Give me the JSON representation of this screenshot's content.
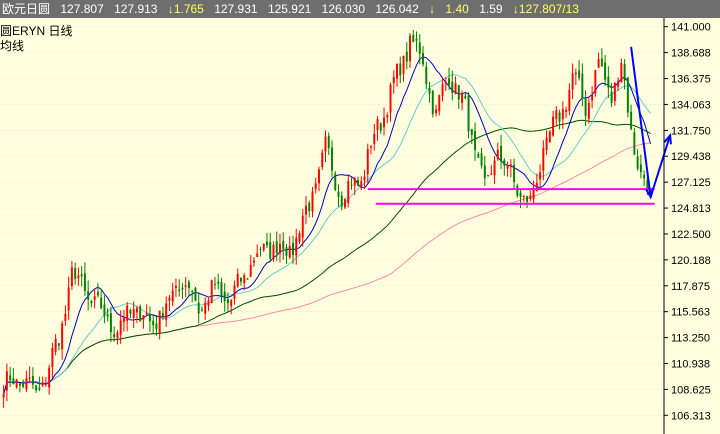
{
  "header": {
    "symbol": "欧元日圆",
    "open": "127.807",
    "high": "127.913",
    "change": "↓1.765",
    "v4": "127.931",
    "v5": "125.921",
    "v6": "126.030",
    "v7": "126.042",
    "arrow": "↓",
    "v8": "1.40",
    "v9": "1.59",
    "v10": "↓127.807/13"
  },
  "legend": {
    "line1": "圆ERYN  日线",
    "line2": "均线"
  },
  "colors": {
    "bg": "#ffffe0",
    "up": "#ff0000",
    "down": "#008000",
    "ma_short": "#0000cc",
    "ma_mid": "#66cccc",
    "ma_long": "#004d00",
    "ma_vlong": "#ff88aa",
    "support": "#ff00ff",
    "annot": "#0000ff",
    "grid": "#cccc99"
  },
  "chart_data": {
    "type": "candlestick",
    "ylim": [
      105.0,
      141.6
    ],
    "yticks": [
      "141.000",
      "138.688",
      "136.375",
      "134.063",
      "131.750",
      "129.438",
      "127.125",
      "124.813",
      "122.500",
      "120.188",
      "117.875",
      "115.563",
      "113.250",
      "110.938",
      "108.625",
      "106.313"
    ],
    "ytick_values": [
      141.0,
      138.688,
      136.375,
      134.063,
      131.75,
      129.438,
      127.125,
      124.813,
      122.5,
      120.188,
      117.875,
      115.563,
      113.25,
      110.938,
      108.625,
      106.313
    ],
    "n_bars": 200,
    "trend": [
      [
        0,
        109.0
      ],
      [
        6,
        109.6
      ],
      [
        10,
        108.0
      ],
      [
        13,
        110.0
      ],
      [
        17,
        113.0
      ],
      [
        21,
        119.0
      ],
      [
        26,
        117.0
      ],
      [
        30,
        115.5
      ],
      [
        35,
        114.0
      ],
      [
        40,
        116.0
      ],
      [
        45,
        114.5
      ],
      [
        50,
        116.0
      ],
      [
        55,
        118.5
      ],
      [
        60,
        116.0
      ],
      [
        65,
        117.5
      ],
      [
        70,
        116.5
      ],
      [
        76,
        120.0
      ],
      [
        82,
        121.5
      ],
      [
        88,
        121.0
      ],
      [
        94,
        125.0
      ],
      [
        99,
        130.0
      ],
      [
        104,
        126.0
      ],
      [
        110,
        127.5
      ],
      [
        115,
        132.0
      ],
      [
        121,
        136.5
      ],
      [
        125,
        139.8
      ],
      [
        129,
        138.0
      ],
      [
        133,
        133.0
      ],
      [
        137,
        137.0
      ],
      [
        142,
        133.5
      ],
      [
        148,
        126.5
      ],
      [
        152,
        130.0
      ],
      [
        157,
        127.0
      ],
      [
        162,
        125.0
      ],
      [
        166,
        130.0
      ],
      [
        171,
        133.0
      ],
      [
        175,
        136.5
      ],
      [
        179,
        134.0
      ],
      [
        183,
        137.5
      ],
      [
        187,
        135.0
      ],
      [
        190,
        137.5
      ],
      [
        193,
        132.0
      ],
      [
        196,
        127.5
      ],
      [
        199,
        126.0
      ]
    ],
    "support_levels": [
      126.5,
      125.2
    ],
    "annotations": [
      {
        "type": "arrow",
        "from": [
          193,
          139.2
        ],
        "to": [
          199,
          125.8
        ]
      },
      {
        "type": "arrow",
        "from": [
          199,
          125.8
        ],
        "to": [
          205,
          131.3
        ]
      }
    ]
  }
}
